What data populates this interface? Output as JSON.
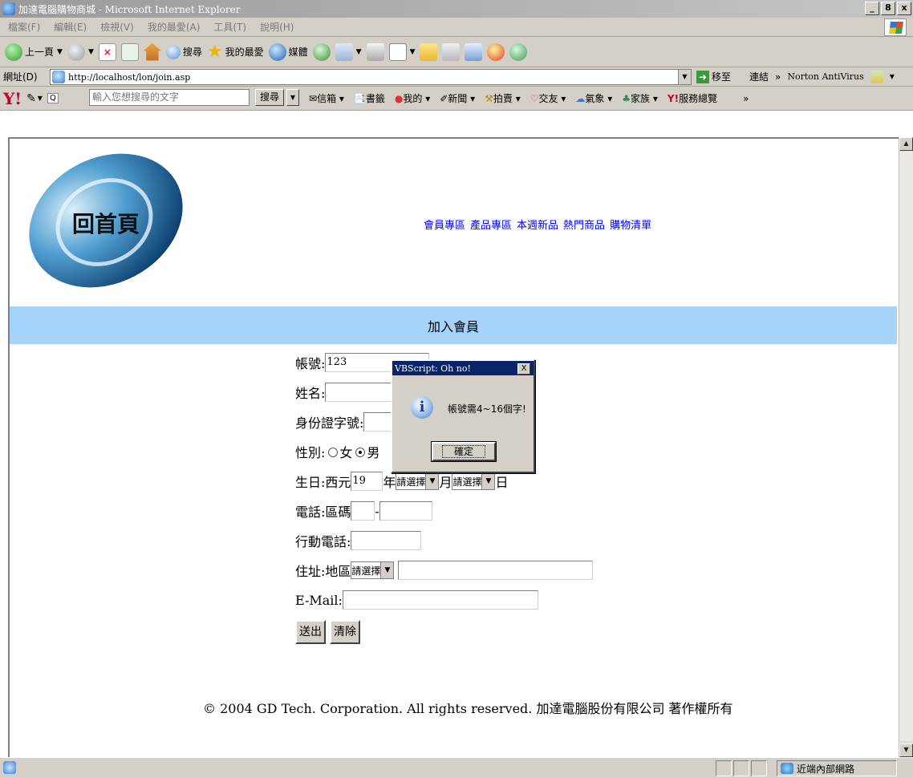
{
  "window": {
    "title": "加達電腦購物商城 - Microsoft Internet Explorer",
    "controls": [
      "_",
      "8",
      "x"
    ]
  },
  "menu": [
    "檔案(F)",
    "編輯(E)",
    "檢視(V)",
    "我的最愛(A)",
    "工具(T)",
    "說明(H)"
  ],
  "toolbar": {
    "back": "上一頁",
    "search": "搜尋",
    "favorites": "我的最愛",
    "media": "媒體"
  },
  "address": {
    "label": "網址(D)",
    "url": "http://localhost/lon/join.asp",
    "go": "移至",
    "links": "連結",
    "more": "»",
    "norton": "Norton AntiVirus"
  },
  "yahoo": {
    "logo": "Y!",
    "search_placeholder": "輸入您想搜尋的文字",
    "search_button": "搜尋",
    "items": [
      "信箱",
      "書籤",
      "我的",
      "新聞",
      "拍賣",
      "交友",
      "氣象",
      "家族",
      "服務總覽"
    ],
    "more": "»"
  },
  "page": {
    "logo_text": "回首頁",
    "nav": [
      "會員專區",
      "產品專區",
      "本週新品",
      "熱門商品",
      "購物清單"
    ],
    "banner": "加入會員"
  },
  "form": {
    "account_label": "帳號:",
    "account_value": "123",
    "name_label": "姓名:",
    "id_label": "身份證字號:",
    "gender_label": "性別:",
    "gender_female": "女",
    "gender_male": "男",
    "birthday_label": "生日:西元",
    "birthday_year_value": "19",
    "year_suffix": "年",
    "month_select": "請選擇",
    "month_suffix": "月",
    "day_select": "請選擇",
    "day_suffix": "日",
    "phone_label": "電話:區碼",
    "phone_dash": "-",
    "mobile_label": "行動電話:",
    "address_label": "住址:地區",
    "area_select": "請選擇",
    "email_label": "E-Mail:",
    "submit": "送出",
    "clear": "清除"
  },
  "footer": "© 2004 GD Tech. Corporation. All rights reserved. 加達電腦股份有限公司 著作權所有",
  "dialog": {
    "title": "VBScript: Oh no!",
    "close": "X",
    "message": "帳號需4~16個字!",
    "ok": "確定"
  },
  "status": {
    "zone": "近端內部網路"
  },
  "colors": {
    "banner": "#a6d3fa",
    "link": "#0000ee",
    "dialog_title": "#0a246a"
  }
}
